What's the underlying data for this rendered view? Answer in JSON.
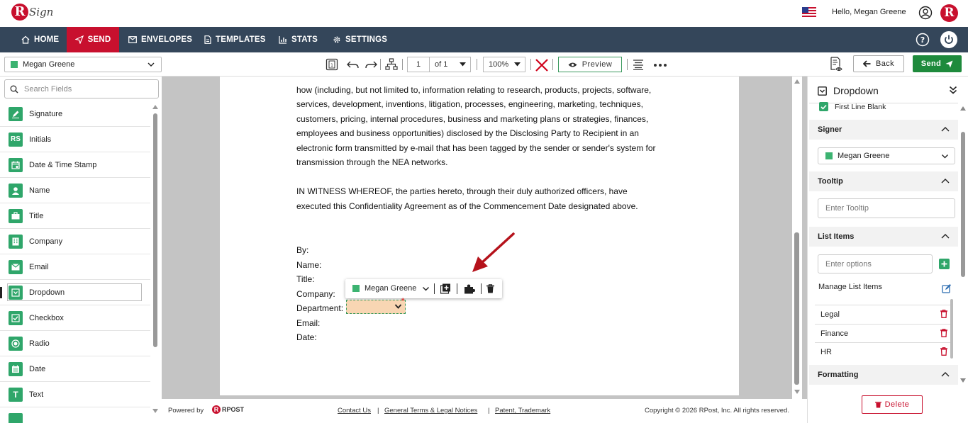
{
  "header": {
    "logo_text": "Sign",
    "greeting": "Hello, Megan Greene"
  },
  "nav": {
    "home": "HOME",
    "send": "SEND",
    "envelopes": "ENVELOPES",
    "templates": "TEMPLATES",
    "stats": "STATS",
    "settings": "SETTINGS"
  },
  "toolbar": {
    "signer": "Megan Greene",
    "page_current": "1",
    "page_of": "of  1",
    "zoom": "100%",
    "preview_label": "Preview",
    "back_label": "Back",
    "send_label": "Send"
  },
  "left_panel": {
    "search_placeholder": "Search Fields",
    "fields": [
      {
        "label": "Signature",
        "icon": "pen-icon"
      },
      {
        "label": "Initials",
        "icon": "initials-icon"
      },
      {
        "label": "Date & Time Stamp",
        "icon": "calendar-clock-icon"
      },
      {
        "label": "Name",
        "icon": "person-icon"
      },
      {
        "label": "Title",
        "icon": "briefcase-icon"
      },
      {
        "label": "Company",
        "icon": "building-icon"
      },
      {
        "label": "Email",
        "icon": "envelope-icon"
      },
      {
        "label": "Dropdown",
        "icon": "dropdown-icon"
      },
      {
        "label": "Checkbox",
        "icon": "checkbox-icon"
      },
      {
        "label": "Radio",
        "icon": "radio-icon"
      },
      {
        "label": "Date",
        "icon": "calendar-icon"
      },
      {
        "label": "Text",
        "icon": "text-icon"
      }
    ]
  },
  "document": {
    "lines": [
      "how (including, but not limited to, information relating to research, products, projects, software,",
      "services, development, inventions, litigation, processes, engineering, marketing, techniques,",
      "customers, pricing, internal procedures, business and marketing plans or strategies, finances,",
      "employees and business opportunities) disclosed by the Disclosing Party to Recipient in an",
      "electronic form transmitted by e-mail that has been tagged by the sender or sender's system for",
      "transmission through the NEA networks.",
      "IN WITNESS WHEREOF, the parties hereto, through their duly authorized officers, have",
      "executed this Confidentiality Agreement as of the Commencement Date designated above.",
      "By:",
      "Name:",
      "Title:",
      "Company:",
      "Department:",
      "Email:",
      "Date:"
    ],
    "field_toolbar_signer": "Megan Greene"
  },
  "footer": {
    "powered_by": "Powered by",
    "brand": "RPOST",
    "contact": "Contact Us",
    "terms": "General Terms & Legal Notices",
    "patent": "Patent, Trademark",
    "copyright": "Copyright © 2026 RPost, Inc. All rights reserved."
  },
  "right_panel": {
    "title": "Dropdown",
    "first_line_blank": "First Line Blank",
    "signer_heading": "Signer",
    "signer_value": "Megan Greene",
    "tooltip_heading": "Tooltip",
    "tooltip_placeholder": "Enter Tooltip",
    "list_items_heading": "List Items",
    "options_placeholder": "Enter options",
    "manage_label": "Manage List Items",
    "items": [
      "Legal",
      "Finance",
      "HR"
    ],
    "formatting_heading": "Formatting",
    "delete_label": "Delete"
  },
  "colors": {
    "brand_red": "#c8102e",
    "nav_bg": "#34465a",
    "accent_green": "#2fa66a"
  }
}
